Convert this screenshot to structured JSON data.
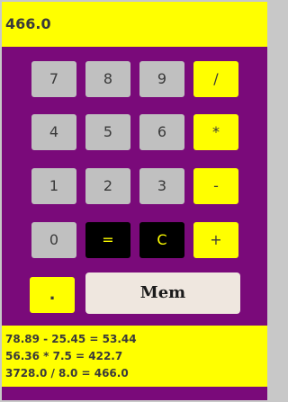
{
  "display": {
    "value": "466.0"
  },
  "buttons": {
    "seven": "7",
    "eight": "8",
    "nine": "9",
    "divide": "/",
    "four": "4",
    "five": "5",
    "six": "6",
    "multiply": "*",
    "one": "1",
    "two": "2",
    "three": "3",
    "subtract": "-",
    "zero": "0",
    "equals": "=",
    "clear": "C",
    "add": "+",
    "decimal": ".",
    "mem": "Mem"
  },
  "history": [
    "78.89 - 25.45 = 53.44",
    "56.36 * 7.5 = 422.7",
    "3728.0 / 8.0 = 466.0"
  ],
  "colors": {
    "background": "#7a0a7a",
    "accent": "#ffff00",
    "digit_button": "#c0c0c0",
    "special_button": "#000000"
  }
}
